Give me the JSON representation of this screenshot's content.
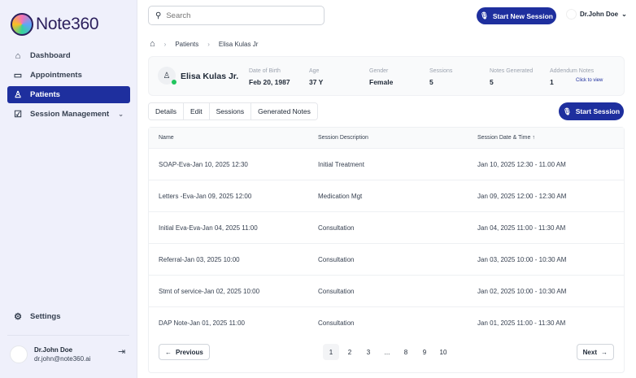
{
  "app": {
    "name": "Note360"
  },
  "sidebar": {
    "items": [
      {
        "label": "Dashboard",
        "icon": "home-icon"
      },
      {
        "label": "Appointments",
        "icon": "calendar-icon"
      },
      {
        "label": "Patients",
        "icon": "user-icon",
        "active": true
      },
      {
        "label": "Session Management",
        "icon": "calendar-check-icon"
      }
    ],
    "settings": "Settings",
    "user": {
      "name": "Dr.John Doe",
      "email": "dr.john@note360.ai"
    }
  },
  "header": {
    "search_placeholder": "Search",
    "start_new_session": "Start New Session",
    "user": "Dr.John Doe"
  },
  "breadcrumb": [
    "Patients",
    "Elisa Kulas Jr"
  ],
  "patient": {
    "name": "Elisa Kulas Jr.",
    "stats": [
      {
        "label": "Date of Birth",
        "value": "Feb 20, 1987"
      },
      {
        "label": "Age",
        "value": "37 Y"
      },
      {
        "label": "Gender",
        "value": "Female"
      },
      {
        "label": "Sessions",
        "value": "5"
      },
      {
        "label": "Notes Generated",
        "value": "5"
      },
      {
        "label": "Addendum Notes",
        "value": "1"
      }
    ],
    "click_to_view": "Click to view"
  },
  "tabs": [
    "Details",
    "Edit",
    "Sessions",
    "Generated Notes"
  ],
  "start_session": "Start Session",
  "table": {
    "columns": [
      "Name",
      "Session Description",
      "Session Date & Time"
    ],
    "rows": [
      [
        "SOAP-Eva-Jan 10, 2025 12:30",
        "Initial Treatment",
        "Jan 10, 2025 12:30 - 11.00 AM"
      ],
      [
        "Letters -Eva-Jan 09, 2025 12:00",
        "Medication Mgt",
        "Jan 09, 2025 12:00 - 12:30 AM"
      ],
      [
        "Initial Eva-Eva-Jan 04, 2025 11:00",
        "Consultation",
        "Jan 04, 2025 11:00 - 11:30 AM"
      ],
      [
        "Referral-Jan 03, 2025 10:00",
        "Consultation",
        "Jan 03, 2025 10:00 - 10:30 AM"
      ],
      [
        "Stmt of service-Jan 02, 2025 10:00",
        "Consultation",
        "Jan 02, 2025 10:00 - 10:30 AM"
      ],
      [
        "DAP Note-Jan 01, 2025 11:00",
        "Consultation",
        "Jan 01, 2025 11:00 - 11:30 AM"
      ]
    ]
  },
  "pagination": {
    "previous": "Previous",
    "next": "Next",
    "pages": [
      "1",
      "2",
      "3",
      "...",
      "8",
      "9",
      "10"
    ],
    "current": "1"
  },
  "colors": {
    "accent": "#1e2f9e",
    "sidebar_bg": "#eff0fb",
    "online": "#22c55e"
  }
}
